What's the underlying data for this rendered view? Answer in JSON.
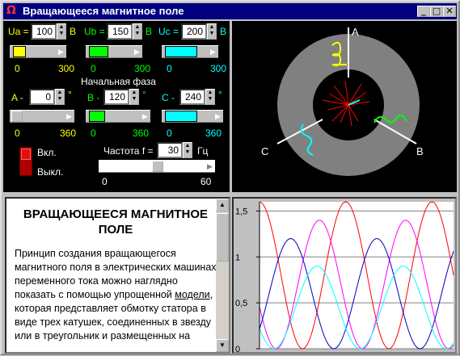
{
  "window": {
    "title": "Вращающееся магнитное поле",
    "app_icon": "omega-icon"
  },
  "voltage": {
    "ua_label": "Ua =",
    "ua_value": "100",
    "ua_unit": "В",
    "ub_label": "Ub =",
    "ub_value": "150",
    "ub_unit": "В",
    "uc_label": "Uc =",
    "uc_value": "200",
    "uc_unit": "В",
    "min": "0",
    "max": "300",
    "ua_level": 0.33,
    "ub_level": 0.5,
    "uc_level": 0.67
  },
  "phase": {
    "title": "Начальная фаза",
    "a_label": "A -",
    "a_value": "0",
    "a_unit": "°",
    "b_label": "B -",
    "b_value": "120",
    "b_unit": "°",
    "c_label": "C -",
    "c_value": "240",
    "c_unit": "°",
    "min": "0",
    "max": "360",
    "a_level": 0.0,
    "b_level": 0.33,
    "c_level": 0.67
  },
  "power": {
    "on_label": "Вкл.",
    "off_label": "Выкл."
  },
  "frequency": {
    "label": "Частота f =",
    "value": "30",
    "unit": "Гц",
    "min": "0",
    "max": "60",
    "level": 0.5
  },
  "motor": {
    "label_a": "A",
    "label_b": "B",
    "label_c": "C"
  },
  "article": {
    "title": "ВРАЩАЮЩЕЕСЯ МАГНИТНОЕ ПОЛЕ",
    "text_1": "Принцип создания вращающегося магнитного поля в электрических машинах переменного тока можно наглядно показать с помощью упрощенной ",
    "link": "модели",
    "text_2": ", которая представляет обмотку статора в виде трех катушек, соединенных в звезду или в треугольник и размещенных на"
  },
  "chart_data": {
    "type": "line",
    "ytick_labels": [
      "1,5",
      "1",
      "0,5",
      "0"
    ],
    "ylim": [
      0,
      1.6
    ],
    "series": [
      {
        "color": "#ff0000",
        "amplitude": 1.6,
        "phase_deg": 0
      },
      {
        "color": "#ff00ff",
        "amplitude": 1.4,
        "phase_deg": 110
      },
      {
        "color": "#0000c0",
        "amplitude": 1.2,
        "phase_deg": 230
      },
      {
        "color": "#00ffff",
        "amplitude": 0.9,
        "phase_deg": 120
      }
    ],
    "colors": {
      "background": "#ffffff",
      "grid": "#808080"
    }
  }
}
